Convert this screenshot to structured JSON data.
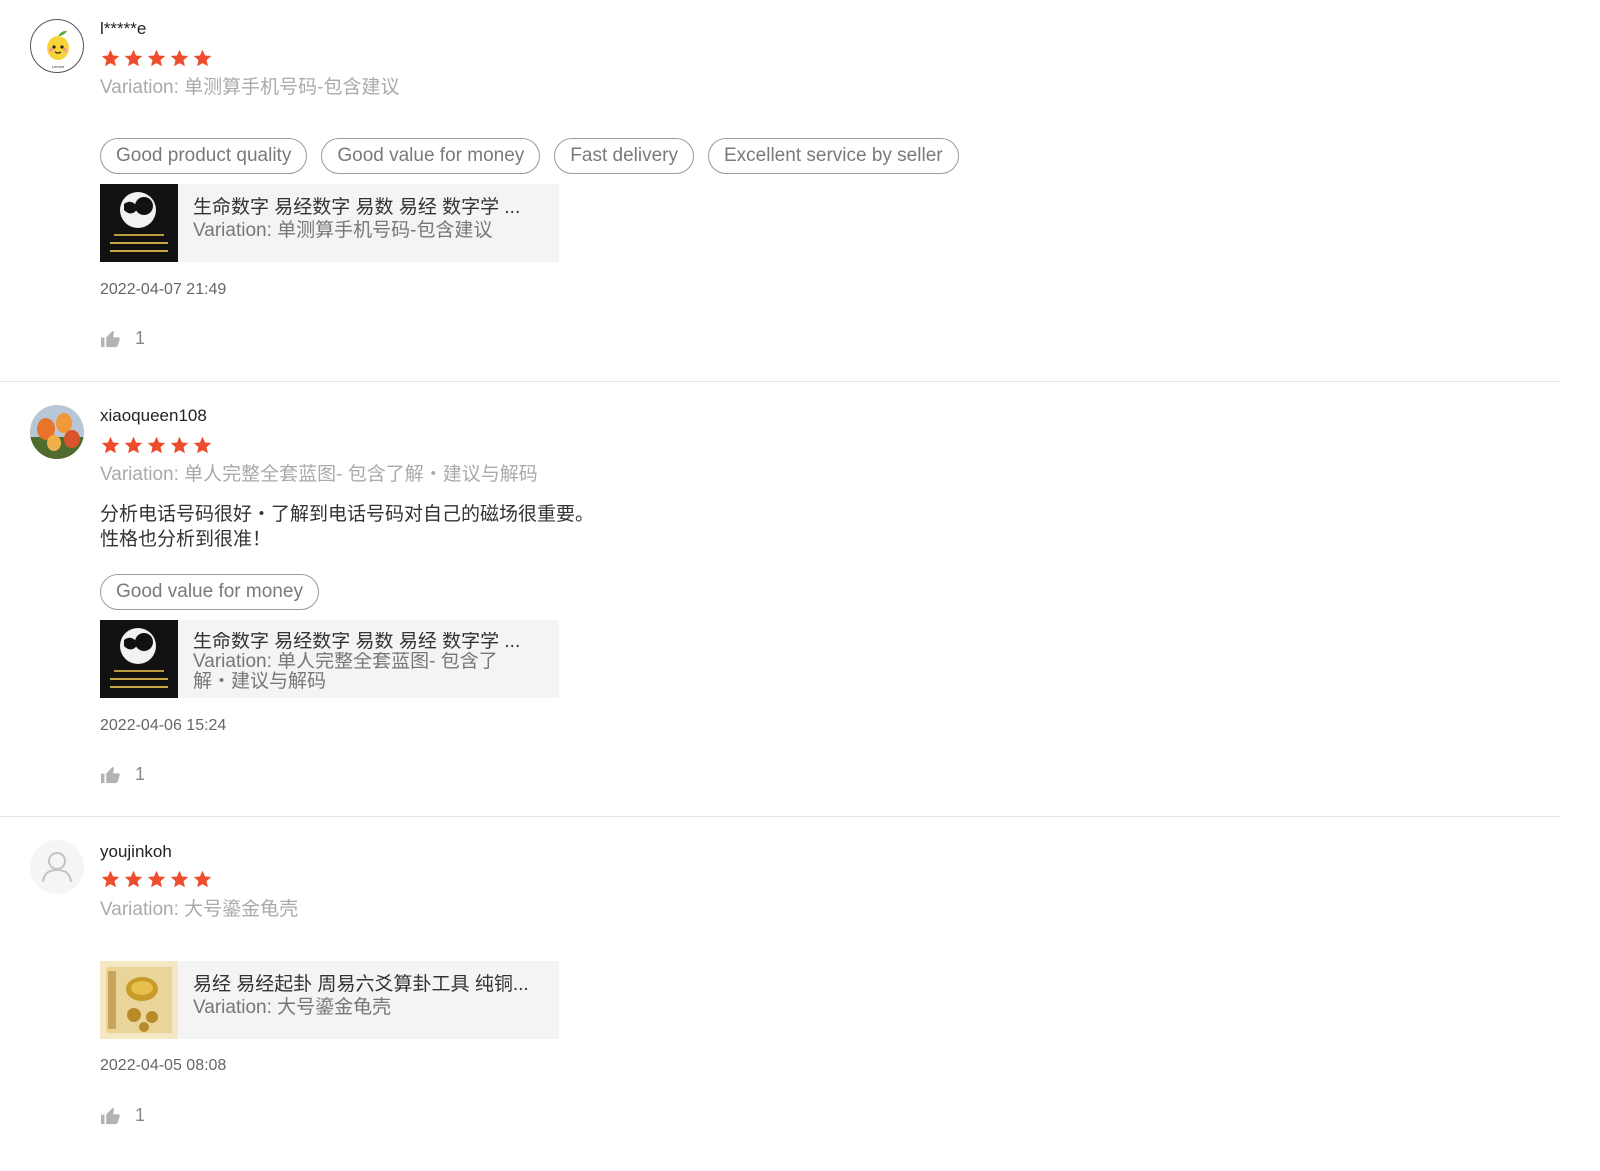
{
  "colors": {
    "star": "#ee4d2d",
    "divider": "#e5e5e5",
    "tag_border": "#9a9a9a",
    "product_bg": "#f4f4f4"
  },
  "reviews": [
    {
      "username": "l*****e",
      "rating": 5,
      "variation": "Variation: 单测算手机号码-包含建议",
      "comment": "",
      "tags": [
        "Good product quality",
        "Good value for money",
        "Fast delivery",
        "Excellent service by seller"
      ],
      "product": {
        "title": "生命数字 易经数字 易数 易经 数字学 ...",
        "variation": "Variation: 单测算手机号码-包含建议",
        "image_icon": "yijing-numbers-thumbnail"
      },
      "date": "2022-04-07 21:49",
      "likes": "1",
      "avatar_icon": "cartoon-lemon-avatar"
    },
    {
      "username": "xiaoqueen108",
      "rating": 5,
      "variation": "Variation: 单人完整全套蓝图- 包含了解・建议与解码",
      "comment": "分析电话号码很好・了解到电话号码对自己的磁场很重要。\n性格也分析到很准！",
      "tags": [
        "Good value for money"
      ],
      "product": {
        "title": "生命数字 易经数字 易数 易经 数字学 ...",
        "variation": "Variation: 单人完整全套蓝图- 包含了解・建议与解码",
        "image_icon": "yijing-numbers-thumbnail"
      },
      "date": "2022-04-06 15:24",
      "likes": "1",
      "avatar_icon": "flowers-photo-avatar"
    },
    {
      "username": "youjinkoh",
      "rating": 5,
      "variation": "Variation: 大号鎏金龟壳",
      "comment": "",
      "tags": [],
      "product": {
        "title": "易经 易经起卦 周易六爻算卦工具 纯铜...",
        "variation": "Variation: 大号鎏金龟壳",
        "image_icon": "golden-turtle-shell-thumbnail"
      },
      "date": "2022-04-05 08:08",
      "likes": "1",
      "avatar_icon": "default-user-avatar"
    }
  ]
}
